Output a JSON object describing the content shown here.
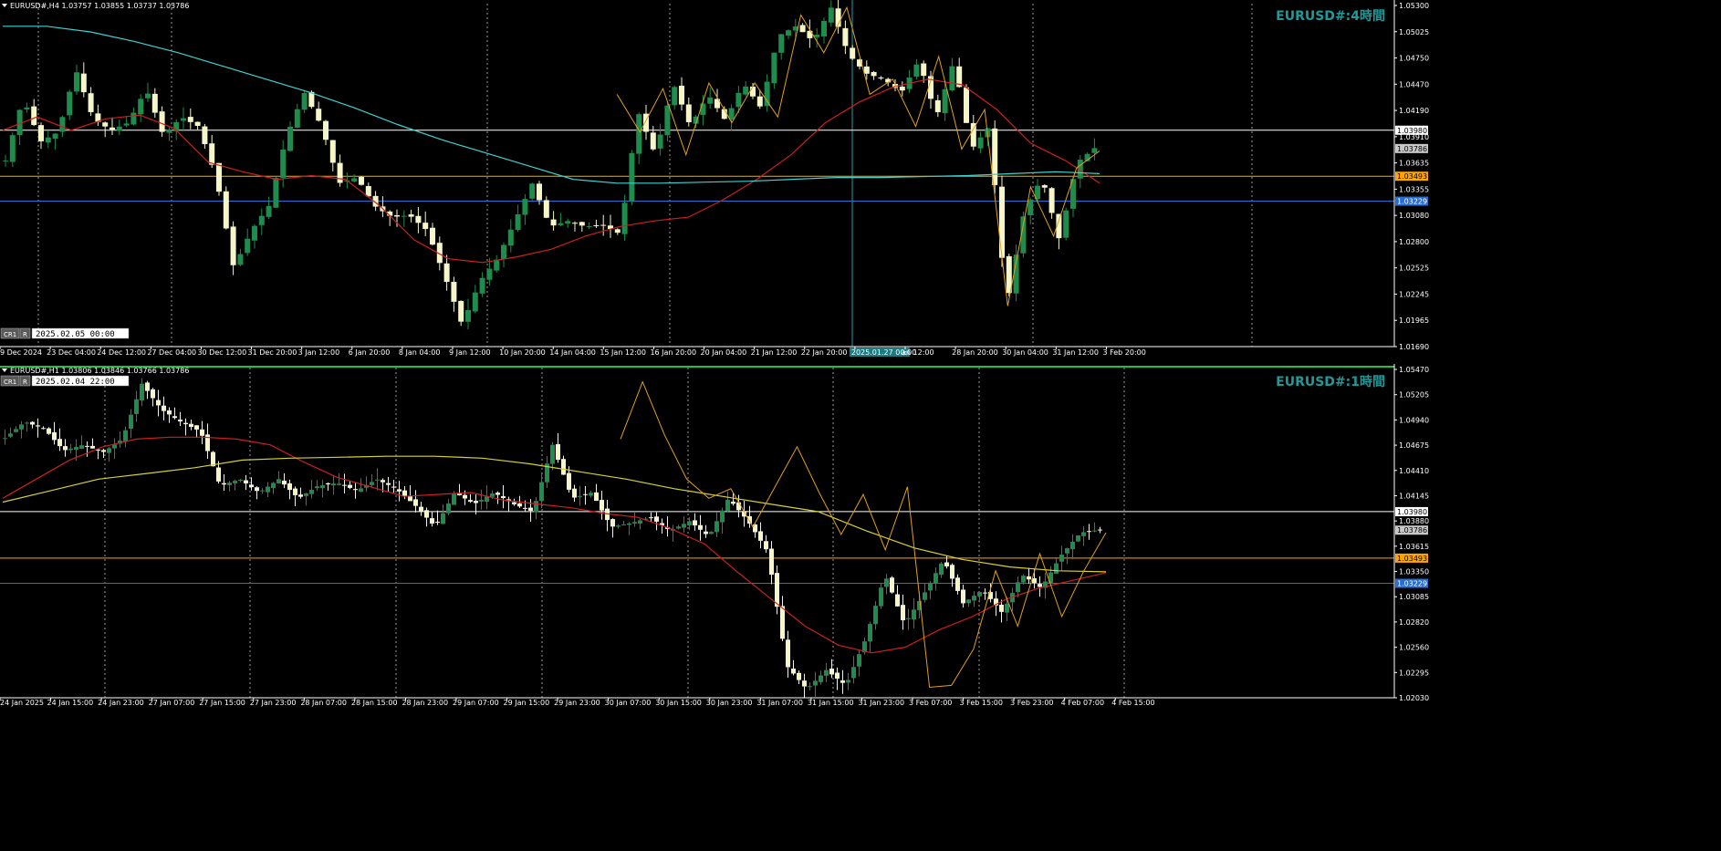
{
  "colors": {
    "background": "#000000",
    "text": "#ffffff",
    "bull": "#1e8c4c",
    "bear": "#f6f6c8",
    "ma_red": "#cc2020",
    "ma_cyan": "#3fd0d0",
    "ma_yellow": "#d8d030",
    "zigzag": "#e0a020",
    "level_white": "#ffffff",
    "level_orange": "#ffa500",
    "level_blue": "#2a6fd0",
    "watermark": "#1f9a9a",
    "panel_border": "#22c040"
  },
  "chart_data": [
    {
      "type": "candlestick",
      "symbol_header": "EURUSD#,H4  1.03757 1.03855 1.03737 1.03786",
      "watermark": "EURUSD#:4時間",
      "date_box": "2025.02.05 00:00",
      "buttons": [
        "CR1",
        "R"
      ],
      "y_ticks": [
        "1.05300",
        "1.05025",
        "1.04750",
        "1.04470",
        "1.04190",
        "1.03910",
        "1.03635",
        "1.03355",
        "1.03080",
        "1.02800",
        "1.02525",
        "1.02245",
        "1.01965",
        "1.01690"
      ],
      "ylim": [
        1.0169,
        1.053
      ],
      "x_ticks": [
        "9 Dec 2024",
        "23 Dec 04:00",
        "24 Dec 12:00",
        "27 Dec 04:00",
        "30 Dec 12:00",
        "31 Dec 20:00",
        "3 Jan 12:00",
        "6 Jan 20:00",
        "8 Jan 04:00",
        "9 Jan 12:00",
        "10 Jan 20:00",
        "14 Jan 04:00",
        "15 Jan 12:00",
        "16 Jan 20:00",
        "20 Jan 04:00",
        "21 Jan 12:00",
        "22 Jan 20:00",
        "2025.01.27 00:00",
        "an 12:00",
        "28 Jan 20:00",
        "30 Jan 04:00",
        "31 Jan 12:00",
        "3 Feb 20:00"
      ],
      "crosshair_label": "2025.01.27 00:00",
      "levels": [
        {
          "value": 1.0398,
          "label": "1.03980",
          "color": "#ffffff"
        },
        {
          "value": 1.03786,
          "label": "1.03786",
          "color": "#c8c8c8"
        },
        {
          "value": 1.03493,
          "label": "1.03493",
          "color": "#ffa500"
        },
        {
          "value": 1.03229,
          "label": "1.03229",
          "color": "#2a6fd0"
        }
      ],
      "path": [
        1.0366,
        1.0432,
        1.0386,
        1.0396,
        1.0462,
        1.041,
        1.0398,
        1.0406,
        1.0442,
        1.0392,
        1.0412,
        1.0402,
        1.0348,
        1.0252,
        1.0292,
        1.0318,
        1.0392,
        1.0438,
        1.0402,
        1.0342,
        1.0348,
        1.0318,
        1.0306,
        1.0308,
        1.0292,
        1.0244,
        1.0192,
        1.0238,
        1.0262,
        1.0302,
        1.0342,
        1.0296,
        1.0302,
        1.0296,
        1.0298,
        1.0288,
        1.0418,
        1.0372,
        1.0448,
        1.0402,
        1.0436,
        1.0408,
        1.0448,
        1.0422,
        1.0498,
        1.0508,
        1.0492,
        1.0528,
        1.0478,
        1.0458,
        1.0452,
        1.0438,
        1.0472,
        1.0412,
        1.0472,
        1.0378,
        1.0402,
        1.0212,
        1.0312,
        1.0348,
        1.0282,
        1.0364,
        1.0379
      ],
      "ma_red": [
        1.0398,
        1.0412,
        1.0398,
        1.041,
        1.0414,
        1.04,
        1.0364,
        1.0354,
        1.0346,
        1.035,
        1.0346,
        1.0318,
        1.0282,
        1.0262,
        1.0258,
        1.0264,
        1.0272,
        1.0286,
        1.0296,
        1.0302,
        1.0306,
        1.0324,
        1.0346,
        1.0372,
        1.0406,
        1.0428,
        1.0444,
        1.0452,
        1.0446,
        1.042,
        1.0384,
        1.0366,
        1.0342
      ],
      "ma_cyan": [
        1.0508,
        1.0508,
        1.0502,
        1.0492,
        1.048,
        1.0466,
        1.0452,
        1.0438,
        1.0422,
        1.0404,
        1.0388,
        1.0374,
        1.036,
        1.0346,
        1.0342,
        1.0342,
        1.0343,
        1.0344,
        1.0346,
        1.0348,
        1.0348,
        1.0349,
        1.035,
        1.0352,
        1.0354,
        1.0352
      ],
      "zigzag": [
        1.0436,
        1.0396,
        1.0442,
        1.0372,
        1.0448,
        1.0406,
        1.0448,
        1.0412,
        1.052,
        1.048,
        1.0528,
        1.0436,
        1.0452,
        1.0402,
        1.0476,
        1.0378,
        1.042,
        1.0212,
        1.0338,
        1.0286,
        1.0358,
        1.0376
      ]
    },
    {
      "type": "candlestick",
      "symbol_header": "EURUSD#,H1  1.03806 1.03846 1.03766 1.03786",
      "watermark": "EURUSD#:1時間",
      "date_box": "2025.02.04 22:00",
      "buttons": [
        "CR1",
        "R"
      ],
      "y_ticks": [
        "1.05470",
        "1.05205",
        "1.04940",
        "1.04675",
        "1.04410",
        "1.04145",
        "1.03880",
        "1.03615",
        "1.03350",
        "1.03085",
        "1.02820",
        "1.02560",
        "1.02295",
        "1.02030"
      ],
      "ylim": [
        1.0203,
        1.0547
      ],
      "x_ticks": [
        "24 Jan 2025",
        "24 Jan 15:00",
        "24 Jan 23:00",
        "27 Jan 07:00",
        "27 Jan 15:00",
        "27 Jan 23:00",
        "28 Jan 07:00",
        "28 Jan 15:00",
        "28 Jan 23:00",
        "29 Jan 07:00",
        "29 Jan 15:00",
        "29 Jan 23:00",
        "30 Jan 07:00",
        "30 Jan 15:00",
        "30 Jan 23:00",
        "31 Jan 07:00",
        "31 Jan 15:00",
        "31 Jan 23:00",
        "3 Feb 07:00",
        "3 Feb 15:00",
        "3 Feb 23:00",
        "4 Feb 07:00",
        "4 Feb 15:00"
      ],
      "levels": [
        {
          "value": 1.0398,
          "label": "1.03980",
          "color": "#ffffff"
        },
        {
          "value": 1.03786,
          "label": "1.03786",
          "color": "#c8c8c8"
        },
        {
          "value": 1.03493,
          "label": "1.03493",
          "color": "#ffa500"
        },
        {
          "value": 1.03229,
          "label": "1.03229",
          "color": "#2a6fd0"
        }
      ],
      "path": [
        1.0475,
        1.0492,
        1.0485,
        1.0462,
        1.0468,
        1.046,
        1.0474,
        1.0532,
        1.0505,
        1.0492,
        1.0482,
        1.0425,
        1.0432,
        1.0418,
        1.0432,
        1.0412,
        1.0425,
        1.0428,
        1.042,
        1.0432,
        1.0422,
        1.0404,
        1.0382,
        1.0418,
        1.0406,
        1.0418,
        1.0406,
        1.0398,
        1.0468,
        1.0412,
        1.0418,
        1.0382,
        1.0386,
        1.0392,
        1.0378,
        1.0388,
        1.0372,
        1.0412,
        1.0388,
        1.0356,
        1.0236,
        1.0212,
        1.0232,
        1.0216,
        1.0264,
        1.0332,
        1.028,
        1.0312,
        1.0348,
        1.0302,
        1.0316,
        1.0292,
        1.0332,
        1.0318,
        1.0352,
        1.0376,
        1.0379
      ],
      "ma_red": [
        1.0412,
        1.0432,
        1.0452,
        1.0466,
        1.0474,
        1.0476,
        1.0476,
        1.0474,
        1.0468,
        1.045,
        1.0434,
        1.0424,
        1.0414,
        1.0416,
        1.0418,
        1.041,
        1.0406,
        1.0402,
        1.0396,
        1.0392,
        1.038,
        1.0364,
        1.0334,
        1.0306,
        1.0278,
        1.0258,
        1.025,
        1.0256,
        1.0274,
        1.0288,
        1.0306,
        1.0318,
        1.0326,
        1.0334
      ],
      "ma_yellow": [
        1.0408,
        1.042,
        1.0432,
        1.0438,
        1.0444,
        1.0452,
        1.0454,
        1.0455,
        1.0456,
        1.0456,
        1.0454,
        1.0448,
        1.044,
        1.0432,
        1.0422,
        1.0414,
        1.0406,
        1.0398,
        1.0378,
        1.036,
        1.0348,
        1.034,
        1.0336,
        1.0335
      ],
      "zigzag": [
        1.0474,
        1.0534,
        1.0478,
        1.0432,
        1.0412,
        1.0422,
        1.0382,
        1.0424,
        1.0466,
        1.0418,
        1.0374,
        1.0416,
        1.0358,
        1.0424,
        1.0214,
        1.0216,
        1.0254,
        1.0336,
        1.0278,
        1.0354,
        1.0288,
        1.0336,
        1.0376
      ]
    }
  ]
}
